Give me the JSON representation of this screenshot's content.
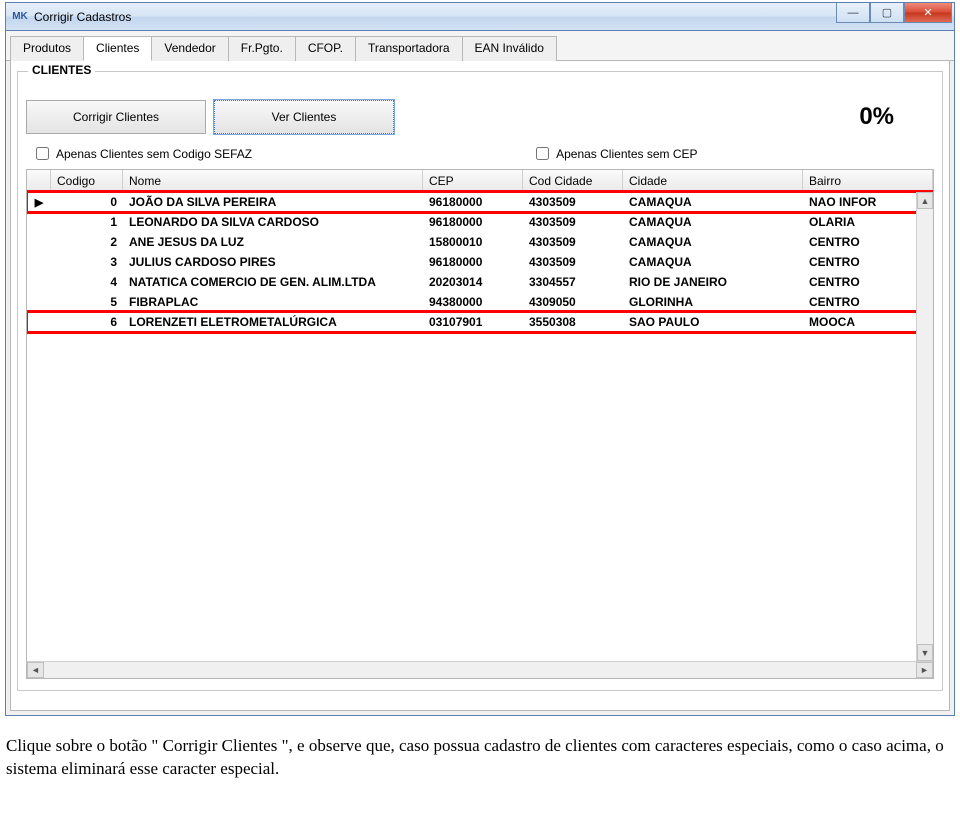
{
  "window": {
    "title": "Corrigir Cadastros",
    "icon_text": "MK"
  },
  "tabs": [
    {
      "label": "Produtos",
      "active": false
    },
    {
      "label": "Clientes",
      "active": true
    },
    {
      "label": "Vendedor",
      "active": false
    },
    {
      "label": "Fr.Pgto.",
      "active": false
    },
    {
      "label": "CFOP.",
      "active": false
    },
    {
      "label": "Transportadora",
      "active": false
    },
    {
      "label": "EAN Inválido",
      "active": false
    }
  ],
  "group_title": "CLIENTES",
  "buttons": {
    "corrigir": "Corrigir Clientes",
    "ver": "Ver Clientes"
  },
  "progress": "0%",
  "checks": {
    "sem_codigo": "Apenas Clientes sem Codigo SEFAZ",
    "sem_cep": "Apenas Clientes sem CEP"
  },
  "grid": {
    "headers": {
      "codigo": "Codigo",
      "nome": "Nome",
      "cep": "CEP",
      "codcid": "Cod Cidade",
      "cidade": "Cidade",
      "bairro": "Bairro"
    },
    "rows": [
      {
        "codigo": "0",
        "nome": "JOÃO DA SILVA PEREIRA",
        "cep": "96180000",
        "codcid": "4303509",
        "cidade": "CAMAQUA",
        "bairro": "NAO INFOR",
        "hl": true,
        "marker": true
      },
      {
        "codigo": "1",
        "nome": "LEONARDO DA SILVA CARDOSO",
        "cep": "96180000",
        "codcid": "4303509",
        "cidade": "CAMAQUA",
        "bairro": "OLARIA",
        "hl": false
      },
      {
        "codigo": "2",
        "nome": "ANE JESUS DA LUZ",
        "cep": "15800010",
        "codcid": "4303509",
        "cidade": "CAMAQUA",
        "bairro": "CENTRO",
        "hl": false
      },
      {
        "codigo": "3",
        "nome": "JULIUS CARDOSO PIRES",
        "cep": "96180000",
        "codcid": "4303509",
        "cidade": "CAMAQUA",
        "bairro": "CENTRO",
        "hl": false
      },
      {
        "codigo": "4",
        "nome": "NATATICA COMERCIO DE GEN. ALIM.LTDA",
        "cep": "20203014",
        "codcid": "3304557",
        "cidade": "RIO DE JANEIRO",
        "bairro": "CENTRO",
        "hl": false
      },
      {
        "codigo": "5",
        "nome": "FIBRAPLAC",
        "cep": "94380000",
        "codcid": "4309050",
        "cidade": "GLORINHA",
        "bairro": "CENTRO",
        "hl": false
      },
      {
        "codigo": "6",
        "nome": "LORENZETI ELETROMETALÚRGICA",
        "cep": "03107901",
        "codcid": "3550308",
        "cidade": "SAO PAULO",
        "bairro": "MOOCA",
        "hl": true
      }
    ]
  },
  "instruction": "Clique sobre o botão \" Corrigir Clientes \", e observe que, caso possua cadastro de clientes com caracteres especiais, como o caso acima, o sistema eliminará esse caracter especial."
}
